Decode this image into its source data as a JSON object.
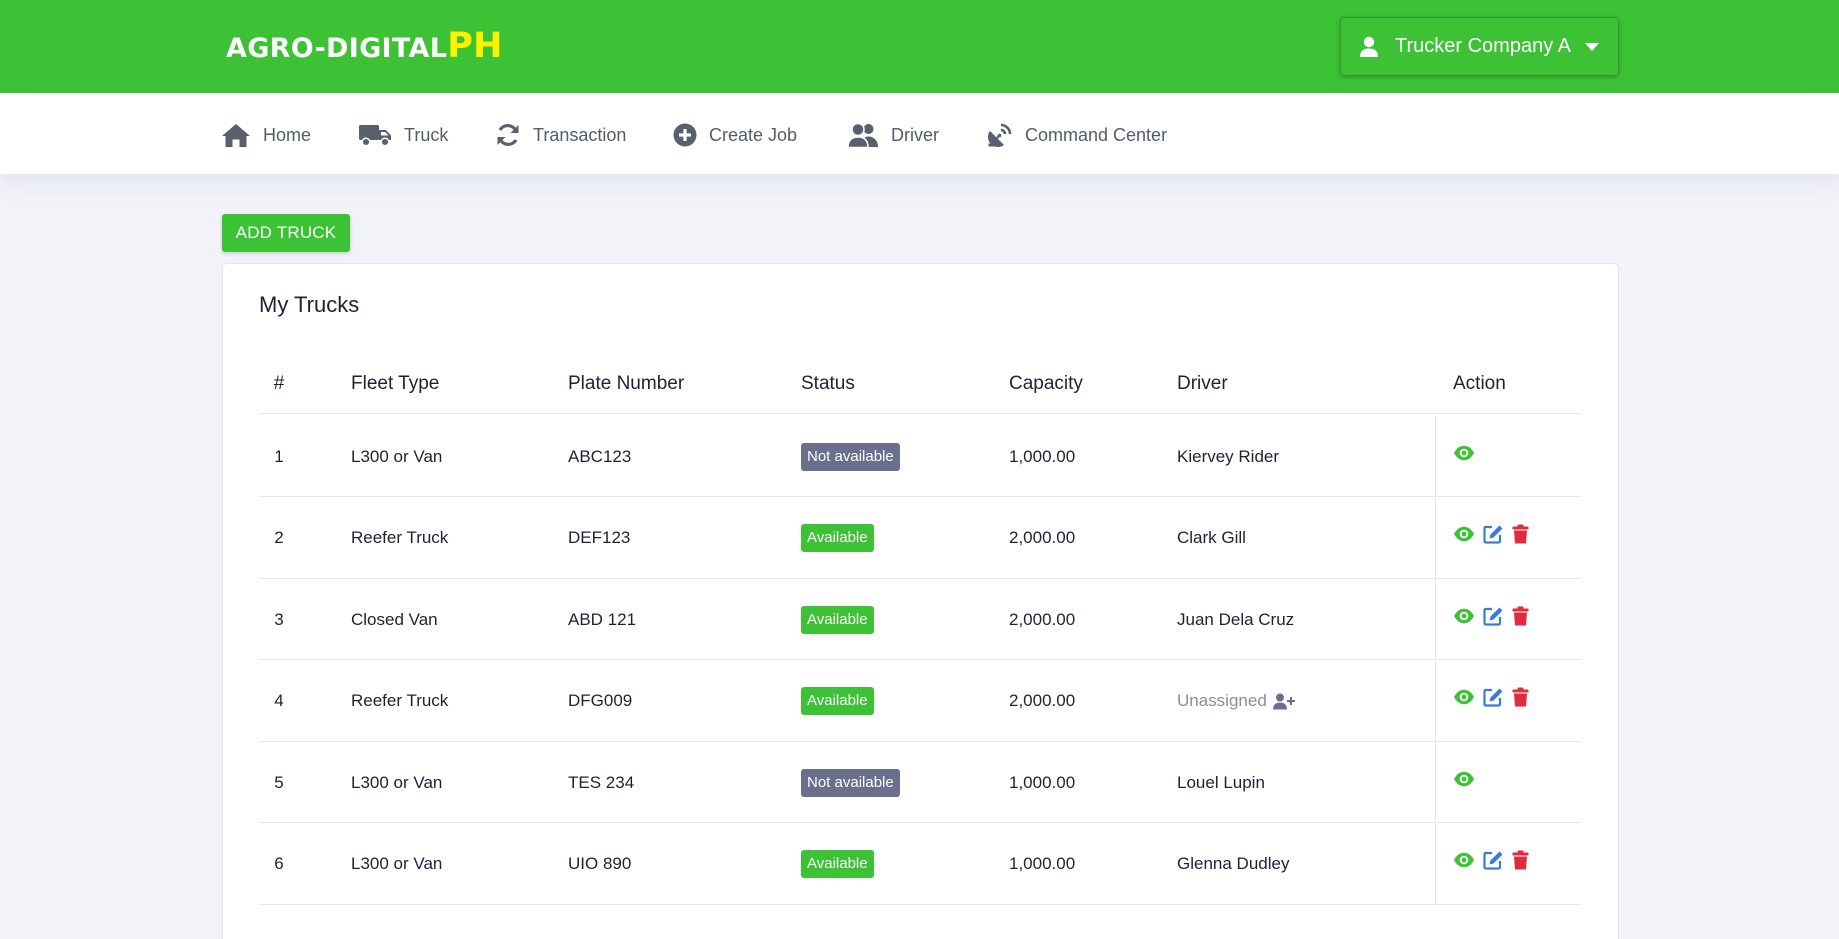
{
  "header": {
    "logo_main": "AGRO-DIGITAL",
    "logo_suffix": "PH",
    "user_menu": "Trucker Company A",
    "colors": {
      "brand_green": "#3dc236",
      "logo_accent": "#fff200"
    }
  },
  "nav": {
    "items": [
      {
        "label": "Home",
        "icon": "home-icon"
      },
      {
        "label": "Truck",
        "icon": "truck-icon"
      },
      {
        "label": "Transaction",
        "icon": "sync-icon"
      },
      {
        "label": "Create Job",
        "icon": "plus-circle-icon"
      },
      {
        "label": "Driver",
        "icon": "users-icon"
      },
      {
        "label": "Command Center",
        "icon": "satellite-dish-icon"
      }
    ]
  },
  "toolbar": {
    "add_truck": "ADD TRUCK"
  },
  "table": {
    "title": "My Trucks",
    "columns": [
      "#",
      "Fleet Type",
      "Plate Number",
      "Status",
      "Capacity",
      "Driver",
      "Action"
    ],
    "rows": [
      {
        "num": "1",
        "fleet": "L300 or Van",
        "plate": "ABC123",
        "status": "Not available",
        "capacity": "1,000.00",
        "driver": "Kiervey Rider"
      },
      {
        "num": "2",
        "fleet": "Reefer Truck",
        "plate": "DEF123",
        "status": "Available",
        "capacity": "2,000.00",
        "driver": "Clark Gill"
      },
      {
        "num": "3",
        "fleet": "Closed Van",
        "plate": "ABD 121",
        "status": "Available",
        "capacity": "2,000.00",
        "driver": "Juan Dela Cruz"
      },
      {
        "num": "4",
        "fleet": "Reefer Truck",
        "plate": "DFG009",
        "status": "Available",
        "capacity": "2,000.00",
        "driver": "Unassigned"
      },
      {
        "num": "5",
        "fleet": "L300 or Van",
        "plate": "TES 234",
        "status": "Not available",
        "capacity": "1,000.00",
        "driver": "Louel Lupin"
      },
      {
        "num": "6",
        "fleet": "L300 or Van",
        "plate": "UIO 890",
        "status": "Available",
        "capacity": "1,000.00",
        "driver": "Glenna Dudley"
      }
    ],
    "status_colors": {
      "Available": "#3dc236",
      "Not available": "#6a6f8d"
    },
    "action_colors": {
      "view": "#3dc236",
      "edit": "#3a7bd5",
      "delete": "#e02b3c"
    }
  }
}
